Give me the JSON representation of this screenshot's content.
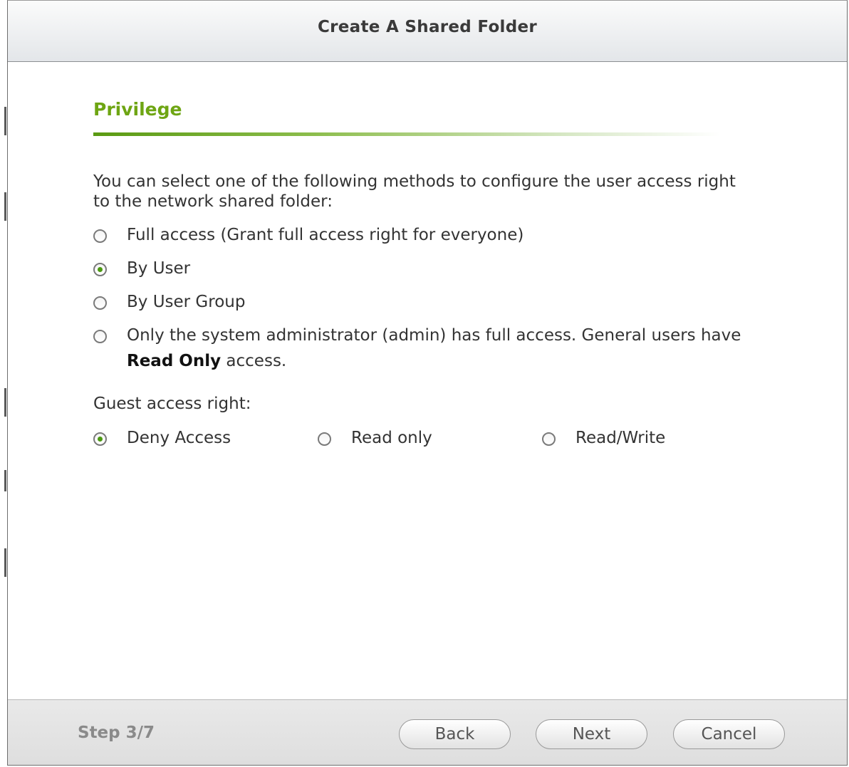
{
  "window": {
    "title": "Create A Shared Folder"
  },
  "section": {
    "title": "Privilege",
    "intro": "You can select one of the following methods to configure the user access right to the network shared folder:"
  },
  "access_options": [
    {
      "label": "Full access (Grant full access right for everyone)",
      "selected": false
    },
    {
      "label": "By User",
      "selected": true
    },
    {
      "label": "By User Group",
      "selected": false
    },
    {
      "label_prefix": "Only the system administrator (admin) has full access. General users have ",
      "label_bold": "Read Only",
      "label_suffix": " access.",
      "selected": false
    }
  ],
  "guest": {
    "label": "Guest access right:",
    "options": [
      {
        "label": "Deny Access",
        "selected": true
      },
      {
        "label": "Read only",
        "selected": false
      },
      {
        "label": "Read/Write",
        "selected": false
      }
    ]
  },
  "footer": {
    "step": "Step 3/7",
    "back_label": "Back",
    "next_label": "Next",
    "cancel_label": "Cancel"
  },
  "colors": {
    "accent_green": "#6ea513",
    "radio_dot": "#4c9a12"
  }
}
